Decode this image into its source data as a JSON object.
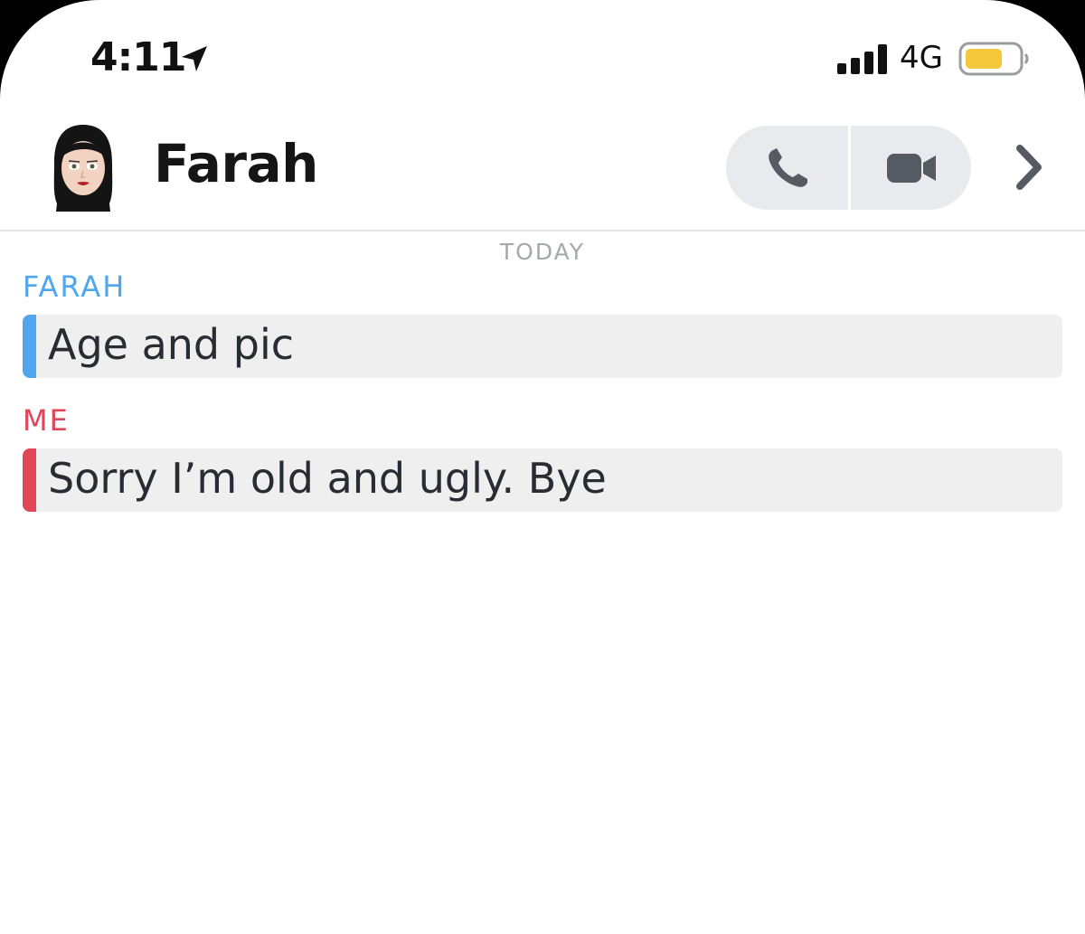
{
  "status_bar": {
    "time": "4:11",
    "network": "4G",
    "battery_color": "#f5c83b",
    "icons": [
      "location-arrow-icon",
      "signal-bars-icon",
      "battery-icon"
    ]
  },
  "header": {
    "contact_name": "Farah",
    "avatar_icon": "bitmoji-avatar",
    "buttons": [
      "phone-icon",
      "video-camera-icon",
      "chevron-right-icon"
    ]
  },
  "chat": {
    "day_label": "TODAY",
    "messages": [
      {
        "sender": "FARAH",
        "text": "Age and pic",
        "color": "#51a6f0"
      },
      {
        "sender": "ME",
        "text": "Sorry I’m old and ugly. Bye",
        "color": "#e04558"
      }
    ]
  }
}
